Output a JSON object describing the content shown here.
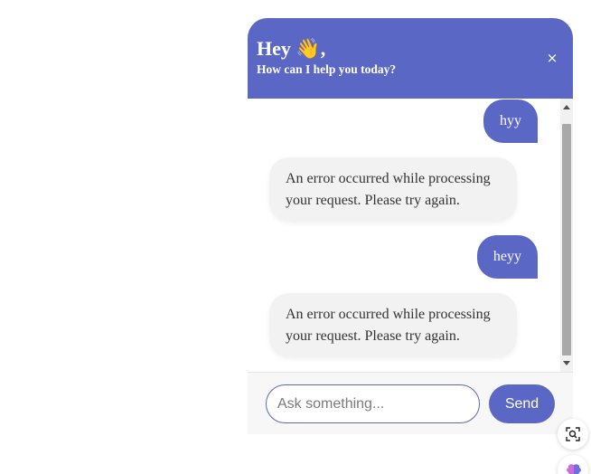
{
  "header": {
    "greeting": "Hey 👋,",
    "subtitle": "How can I help you today?",
    "close_icon": "×"
  },
  "messages": [
    {
      "role": "user",
      "text": "hyy"
    },
    {
      "role": "bot",
      "line1": "An error occurred while processing",
      "line2": "your request. Please try again."
    },
    {
      "role": "user",
      "text": "heyy"
    },
    {
      "role": "bot",
      "line1": "An error occurred while processing",
      "line2": "your request. Please try again."
    }
  ],
  "input": {
    "placeholder": "Ask something...",
    "value": ""
  },
  "send_label": "Send",
  "colors": {
    "accent": "#5b67c4",
    "bot_bubble": "#f2f2f2",
    "panel_bg": "#f7f7f7"
  },
  "floating_buttons": {
    "capture": "screen-capture-icon",
    "brain": "brain-icon"
  }
}
